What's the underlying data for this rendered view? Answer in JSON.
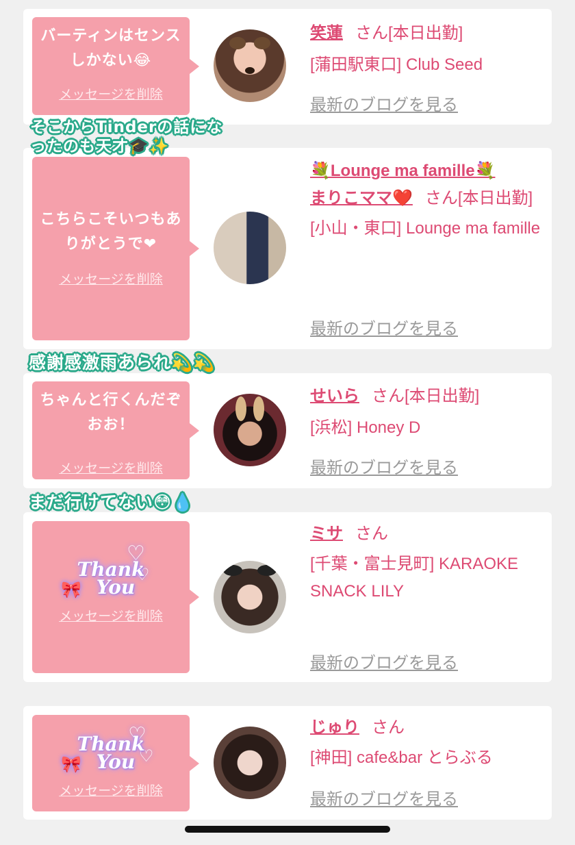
{
  "cards": [
    {
      "message": "バーティンはセンスしかない😂",
      "delete_label": "メッセージを削除",
      "prefix": "",
      "name": "笑蓮",
      "suffix": "さん[本日出勤]",
      "shop": "[蒲田駅東口] Club Seed",
      "blog_link": "最新のブログを見る"
    },
    {
      "message": "こちらこそいつもありがとうで❤",
      "delete_label": "メッセージを削除",
      "prefix": "💐Lounge ma famille💐",
      "name": "まりこママ❤️",
      "suffix": "さん[本日出勤]",
      "shop": "[小山・東口] Lounge ma famille",
      "blog_link": "最新のブログを見る"
    },
    {
      "message": "ちゃんと行くんだぞおお！",
      "delete_label": "メッセージを削除",
      "prefix": "",
      "name": "せいら",
      "suffix": "さん[本日出勤]",
      "shop": "[浜松] Honey D",
      "blog_link": "最新のブログを見る"
    },
    {
      "message": "",
      "sticker_text_line1": "Thank",
      "sticker_text_line2": "You",
      "delete_label": "メッセージを削除",
      "prefix": "",
      "name": "ミサ",
      "suffix": "さん",
      "shop": "[千葉・富士見町] KARAOKE SNACK LILY",
      "blog_link": "最新のブログを見る"
    },
    {
      "message": "",
      "sticker_text_line1": "Thank",
      "sticker_text_line2": "You",
      "delete_label": "メッセージを削除",
      "prefix": "",
      "name": "じゅり",
      "suffix": "さん",
      "shop": "[神田] cafe&bar とらぶる",
      "blog_link": "最新のブログを見る"
    }
  ],
  "overlay_captions": [
    "そこからTinderの話になったのも天才🎓✨",
    "感謝感激雨あられ💫💫",
    "まだ行けてない😳💧"
  ],
  "colors": {
    "bubble": "#f5a0ab",
    "accent": "#dd4a73",
    "link_gray": "#9a9a9a",
    "caption_outline": "#2aa98a"
  }
}
